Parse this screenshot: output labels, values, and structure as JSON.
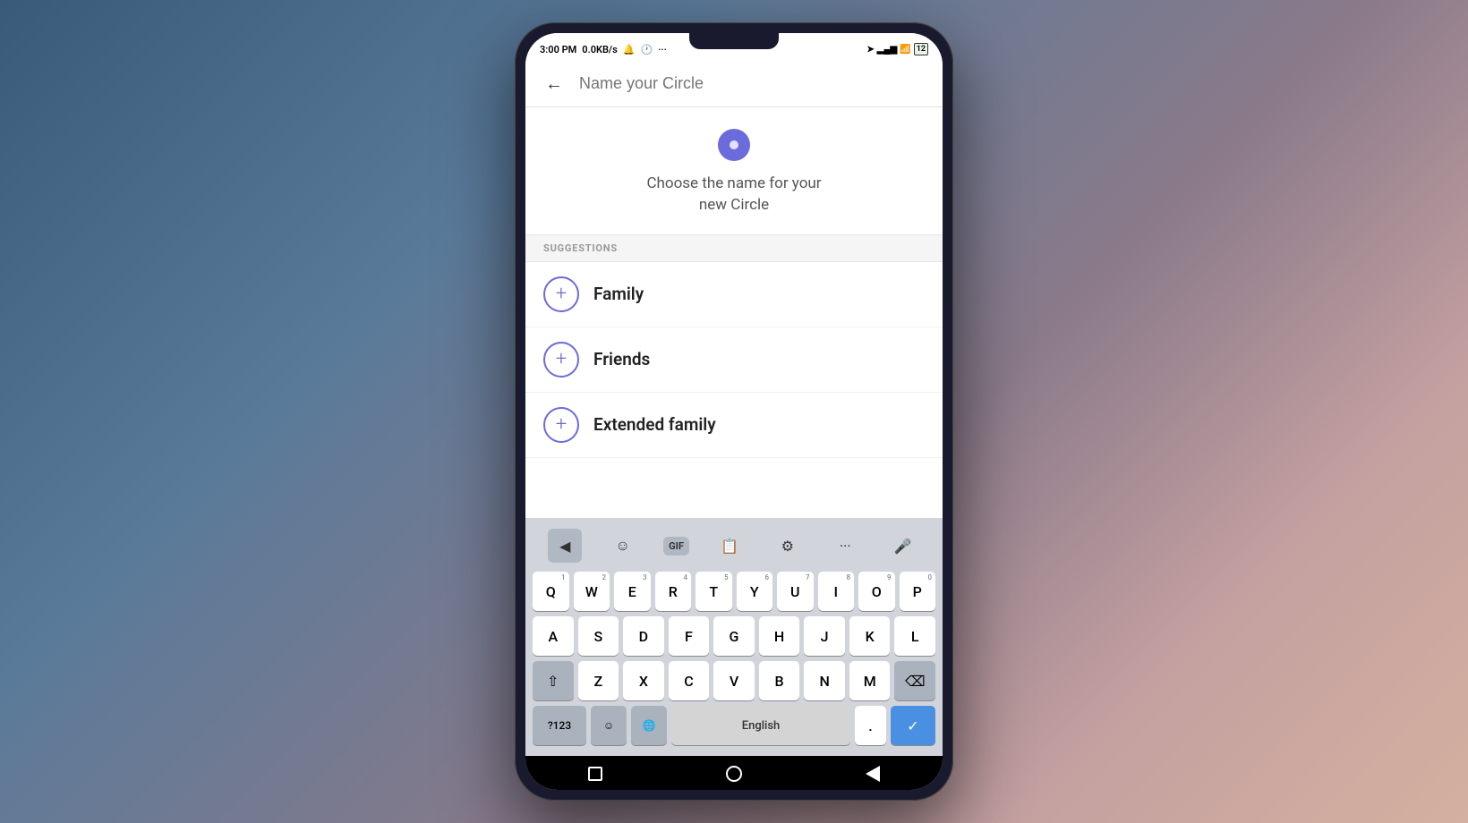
{
  "background": {
    "gradient": "mountain landscape dusk"
  },
  "status_bar": {
    "time": "3:00 PM",
    "data_speed": "0.0KB/s",
    "icons": [
      "alarm",
      "clock",
      "dots"
    ],
    "right_icons": [
      "location",
      "signal",
      "wifi",
      "battery"
    ],
    "battery_label": "12"
  },
  "nav_header": {
    "back_label": "←",
    "input_placeholder": "Name your Circle"
  },
  "circle_section": {
    "title_line1": "Choose the name for your",
    "title_line2": "new Circle"
  },
  "suggestions": {
    "header": "SUGGESTIONS",
    "items": [
      {
        "id": "family",
        "label": "Family"
      },
      {
        "id": "friends",
        "label": "Friends"
      },
      {
        "id": "extended-family",
        "label": "Extended family"
      }
    ]
  },
  "keyboard": {
    "toolbar": {
      "back_icon": "◀",
      "emoji_icon": "☺",
      "gif_label": "GIF",
      "clipboard_icon": "📋",
      "settings_icon": "⚙",
      "more_icon": "···",
      "mic_icon": "🎤"
    },
    "rows": [
      [
        {
          "key": "Q",
          "num": "1"
        },
        {
          "key": "W",
          "num": "2"
        },
        {
          "key": "E",
          "num": "3"
        },
        {
          "key": "R",
          "num": "4"
        },
        {
          "key": "T",
          "num": "5"
        },
        {
          "key": "Y",
          "num": "6"
        },
        {
          "key": "U",
          "num": "7"
        },
        {
          "key": "I",
          "num": "8"
        },
        {
          "key": "O",
          "num": "9"
        },
        {
          "key": "P",
          "num": "0"
        }
      ],
      [
        {
          "key": "A"
        },
        {
          "key": "S"
        },
        {
          "key": "D"
        },
        {
          "key": "F"
        },
        {
          "key": "G"
        },
        {
          "key": "H"
        },
        {
          "key": "J"
        },
        {
          "key": "K"
        },
        {
          "key": "L"
        }
      ],
      [
        {
          "key": "⇧",
          "dark": true
        },
        {
          "key": "Z"
        },
        {
          "key": "X"
        },
        {
          "key": "C"
        },
        {
          "key": "V"
        },
        {
          "key": "B"
        },
        {
          "key": "N"
        },
        {
          "key": "M"
        },
        {
          "key": "⌫",
          "dark": true
        }
      ]
    ],
    "bottom_row": {
      "num_label": "?123",
      "emoji_label": "☺",
      "lang_label": "🌐",
      "space_label": "English",
      "period_label": ".",
      "enter_icon": "✓"
    }
  },
  "bottom_nav": {
    "square": "□",
    "home": "○",
    "back": "◁"
  }
}
